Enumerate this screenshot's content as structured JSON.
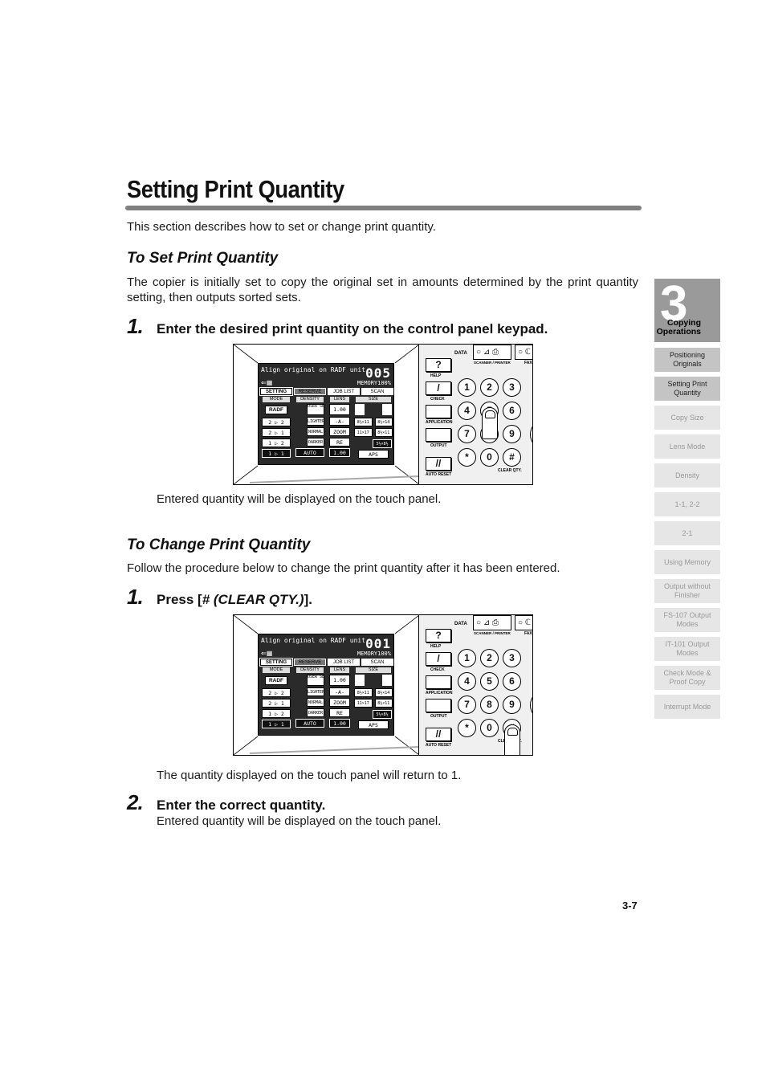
{
  "page": {
    "title": "Setting Print Quantity",
    "intro": "This section describes how to set or change print quantity.",
    "page_number": "3-7"
  },
  "section_set": {
    "heading": "To Set Print Quantity",
    "paragraph": "The copier is initially set to copy the original set in amounts determined by the print quantity setting, then outputs sorted sets.",
    "step1": {
      "number": "1.",
      "text": "Enter the desired print quantity on the control panel keypad."
    },
    "note": "Entered quantity will be displayed on the touch panel."
  },
  "section_change": {
    "heading": "To Change Print Quantity",
    "paragraph": "Follow the procedure below to change the print quantity after it has been entered.",
    "step1": {
      "number": "1.",
      "prefix": "Press [",
      "key": "# (CLEAR QTY.)",
      "suffix": "]."
    },
    "step1_note": "The quantity displayed on the touch panel will return to 1.",
    "step2": {
      "number": "2.",
      "text": "Enter the correct quantity."
    },
    "step2_note": "Entered quantity will be displayed on the touch panel."
  },
  "touch_panel": {
    "message": "Align original on RADF unit",
    "memory": "MEMORY100%",
    "tabs": [
      "SETTING",
      "RESERVE",
      "JOB LIST",
      "SCAN"
    ],
    "columns": {
      "mode": {
        "header": "MODE",
        "buttons": [
          "RADF",
          "2 ▷ 2",
          "2 ▷ 1",
          "1 ▷ 2",
          "1 ▷ 1"
        ]
      },
      "density": {
        "header": "DENSITY",
        "buttons": [
          "USER SET",
          "LIGHTER",
          "NORMAL",
          "DARKER",
          "AUTO"
        ]
      },
      "lens": {
        "header": "LENS",
        "buttons": [
          "1.00",
          "-A-",
          "ZOOM",
          "RE",
          "1.00"
        ]
      },
      "size": {
        "header": "SIZE",
        "buttons": [
          "8½×11",
          "8½×14",
          "11×17",
          "8½×11",
          "5½×8½",
          "APS"
        ]
      }
    }
  },
  "figures": [
    {
      "quantity": "005",
      "pressed_key": "5"
    },
    {
      "quantity": "001",
      "pressed_key": "#"
    }
  ],
  "control_panel": {
    "data_label": "DATA",
    "scanner_printer_label": "SCANNER / PRINTER",
    "fax_label": "FAX",
    "side_buttons": [
      {
        "label": "HELP",
        "glyph": "?"
      },
      {
        "label": "CHECK",
        "glyph": "/"
      },
      {
        "label": "APPLICATION",
        "glyph": ""
      },
      {
        "label": "OUTPUT",
        "glyph": ""
      },
      {
        "label": "AUTO RESET",
        "glyph": "//"
      }
    ],
    "keys": [
      "1",
      "2",
      "3",
      "4",
      "5",
      "6",
      "7",
      "8",
      "9",
      "*",
      "0",
      "#"
    ],
    "clear_qty_label": "CLEAR QTY."
  },
  "side_nav": {
    "chapter_number": "3",
    "chapter_title": "Copying Operations",
    "items": [
      {
        "label": "Positioning Originals",
        "active": true
      },
      {
        "label": "Setting Print Quantity",
        "active": true
      },
      {
        "label": "Copy Size",
        "active": false
      },
      {
        "label": "Lens Mode",
        "active": false
      },
      {
        "label": "Density",
        "active": false
      },
      {
        "label": "1-1, 2-2",
        "active": false
      },
      {
        "label": "2-1",
        "active": false
      },
      {
        "label": "Using Memory",
        "active": false
      },
      {
        "label": "Output without Finisher",
        "active": false
      },
      {
        "label": "FS-107 Output Modes",
        "active": false
      },
      {
        "label": "IT-101 Output Modes",
        "active": false
      },
      {
        "label": "Check Mode & Proof Copy",
        "active": false
      },
      {
        "label": "Interrupt Mode",
        "active": false
      }
    ]
  }
}
